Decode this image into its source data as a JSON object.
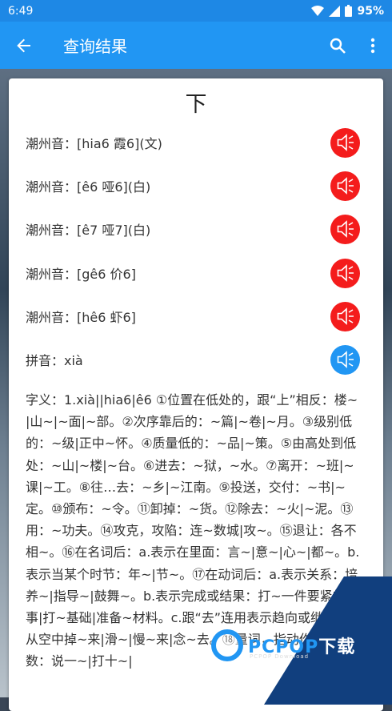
{
  "status_bar": {
    "time": "6:49",
    "battery": "95%"
  },
  "app_bar": {
    "title": "查询结果"
  },
  "result": {
    "character": "下",
    "pronunciations": [
      {
        "label": "潮州音：[hia6 霞6](文)"
      },
      {
        "label": "潮州音：[ê6 哑6](白)"
      },
      {
        "label": "潮州音：[ê7 哑7](白)"
      },
      {
        "label": "潮州音：[gê6 价6]"
      },
      {
        "label": "潮州音：[hê6 虾6]"
      }
    ],
    "pinyin": "拼音：xià",
    "meaning": "字义：1.xià||hia6|ê6 ①位置在低处的，跟“上”相反：楼~|山~|~面|~部。②次序靠后的：~篇|~卷|~月。③级别低的：~级|正中~怀。④质量低的：~品|~策。⑤由高处到低处：~山|~楼|~台。⑥进去：~狱，~水。⑦离开：~班|~课|~工。⑧往…去：~乡|~江南。⑨投送，交付：~书|~定。⑩颁布：~令。⑪卸掉：~货。⑫除去：~火|~泥。⑬用：~功夫。⑭攻克，攻陷：连~数城|攻~。⑮退让：各不相~。⑯在名词后：a.表示在里面：言~|意~|心~|都~。b.表示当某个时节：年~|节~。⑰在动词后：a.表示关系：培养~|指导~|鼓舞~。b.表示完成或结果：打~一件要紧的事|打~基础|准备~材料。c.跟“去”连用表示趋向或继续：从空中掉~来|滑~|慢~来|念~去。⑱量词，指动作的次数：说一~|打十~|"
  },
  "watermark": {
    "brand_main": "PCPOP",
    "brand_suffix": "下载",
    "sub": "PCPOP Download"
  },
  "colors": {
    "primary": "#2196f3",
    "status": "#1e88e5",
    "speaker_red": "#f41c1c"
  }
}
